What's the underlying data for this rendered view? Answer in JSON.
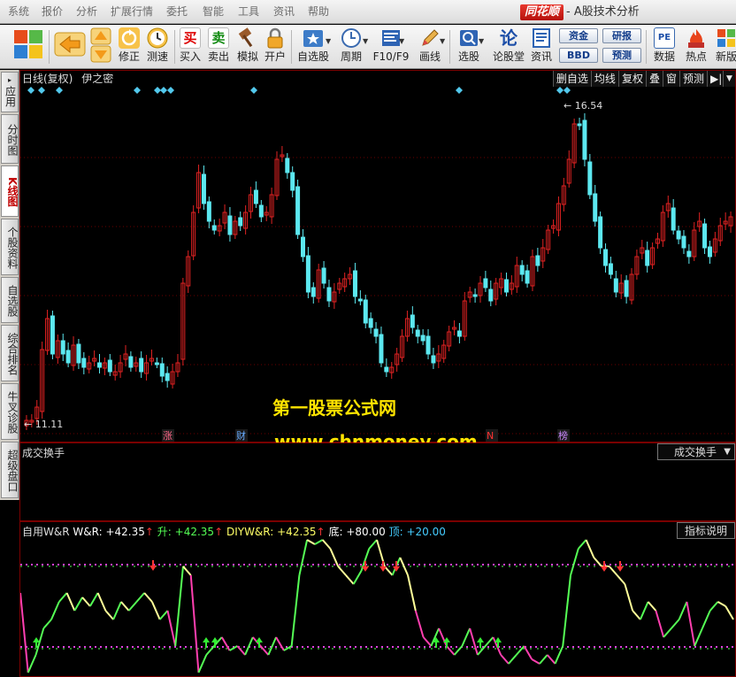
{
  "menubar": {
    "items": [
      "系统",
      "报价",
      "分析",
      "扩展行情",
      "委托",
      "智能",
      "工具",
      "资讯",
      "帮助"
    ],
    "brand": "同花顺",
    "title": "- A股技术分析"
  },
  "toolbar": {
    "buttons": [
      {
        "label": "",
        "icon": "windows-icon"
      },
      {
        "label": "",
        "icon": "back-arrow-icon"
      },
      {
        "label": "",
        "icon": "up-down-arrows-icon"
      },
      {
        "label": "修正",
        "icon": "refresh-icon"
      },
      {
        "label": "测速",
        "icon": "clock-icon"
      },
      {
        "label": "买入",
        "icon": "buy-icon",
        "glyph": "买"
      },
      {
        "label": "卖出",
        "icon": "sell-icon",
        "glyph": "卖"
      },
      {
        "label": "模拟",
        "icon": "hammer-icon"
      },
      {
        "label": "开户",
        "icon": "lock-icon"
      },
      {
        "label": "自选股",
        "icon": "star-icon"
      },
      {
        "label": "周期",
        "icon": "clock-cycle-icon"
      },
      {
        "label": "F10/F9",
        "icon": "document-icon"
      },
      {
        "label": "画线",
        "icon": "pencil-icon"
      },
      {
        "label": "选股",
        "icon": "select-stock-icon"
      },
      {
        "label": "论股堂",
        "icon": "forum-icon",
        "glyph": "论"
      },
      {
        "label": "资讯",
        "icon": "news-icon"
      },
      {
        "label": "数据",
        "icon": "pe-data-icon",
        "glyph": "PE"
      },
      {
        "label": "热点",
        "icon": "hot-icon"
      },
      {
        "label": "新版",
        "icon": "new-version-icon"
      }
    ],
    "mini": [
      "资金",
      "BBD",
      "研报",
      "预测"
    ]
  },
  "lefttabs": [
    "应用",
    "分时图",
    "K线图",
    "个股资料",
    "自选股",
    "综合排名",
    "牛叉诊股",
    "超级盘口"
  ],
  "chart": {
    "period": "日线(复权)",
    "formula": "伊之密",
    "tabs": [
      "删自选",
      "均线",
      "复权",
      "叠",
      "窗",
      "预测"
    ],
    "high_label": "16.54",
    "low_label": "11.11",
    "event_markers": [
      "涨",
      "财",
      "N",
      "榜"
    ],
    "colors": {
      "up": "#e02222",
      "down": "#5ce8f0",
      "diamond": "#52c8ec"
    }
  },
  "volume_panel": {
    "title": "成交换手",
    "selector": "成交换手"
  },
  "indicator_panel": {
    "legend_prefix": "自用W&R",
    "items": [
      {
        "label": "W&R:",
        "value": "+42.35",
        "arrow": "↑",
        "color": "#ffffff"
      },
      {
        "label": "升:",
        "value": "+42.35",
        "arrow": "↑",
        "color": "#55ff55"
      },
      {
        "label": "DIYW&R:",
        "value": "+42.35",
        "arrow": "↑",
        "color": "#ffff66"
      },
      {
        "label": "底:",
        "value": "+80.00",
        "arrow": "",
        "color": "#ffffff"
      },
      {
        "label": "顶:",
        "value": "+20.00",
        "arrow": "",
        "color": "#44ccff"
      }
    ],
    "help_button": "指标说明",
    "levels": {
      "top_line": 80,
      "bottom_line": 20
    }
  },
  "watermark": {
    "line1": "第一股票公式网",
    "line2": "www.chnmoney.com"
  }
}
